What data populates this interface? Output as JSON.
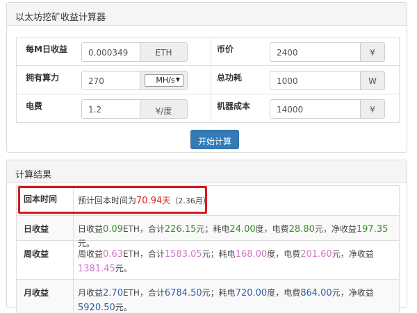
{
  "calc": {
    "title": "以太坊挖矿收益计算器",
    "rows": [
      {
        "left_label": "每M日收益",
        "left_value": "0.000349",
        "left_unit": "ETH",
        "right_label": "币价",
        "right_value": "2400",
        "right_unit": "¥"
      },
      {
        "left_label": "拥有算力",
        "left_value": "270",
        "left_unit_select": "MH/s",
        "right_label": "总功耗",
        "right_value": "1000",
        "right_unit": "W"
      },
      {
        "left_label": "电费",
        "left_value": "1.2",
        "left_unit": "¥/度",
        "right_label": "机器成本",
        "right_value": "14000",
        "right_unit": "¥"
      }
    ],
    "start_button": "开始计算"
  },
  "result": {
    "title": "计算结果",
    "payback": {
      "label": "回本时间",
      "prefix": "预计回本时间为",
      "days": "70.94",
      "days_unit": "天",
      "months": "（2.36月）"
    },
    "daily": {
      "label": "日收益",
      "t1": "日收益",
      "v1": "0.09",
      "t2": "ETH，合计",
      "v2": "226.15",
      "t3": "元；耗电",
      "v3": "24.00",
      "t4": "度，电费",
      "v4": "28.80",
      "t5": "元，净收益",
      "v5": "197.35",
      "t6": "元。"
    },
    "weekly": {
      "label": "周收益",
      "t1": "周收益",
      "v1": "0.63",
      "t2": "ETH，合计",
      "v2": "1583.05",
      "t3": "元；耗电",
      "v3": "168.00",
      "t4": "度，电费",
      "v4": "201.60",
      "t5": "元，净收益",
      "v5": "1381.45",
      "t6": "元。"
    },
    "monthly": {
      "label": "月收益",
      "t1": "月收益",
      "v1": "2.70",
      "t2": "ETH，合计",
      "v2": "6784.50",
      "t3": "元；耗电",
      "v3": "720.00",
      "t4": "度，电费",
      "v4": "864.00",
      "t5": "元，净收益",
      "v5": "5920.50",
      "t6": "元。"
    }
  },
  "colors": {
    "primary_button": "#337ab7",
    "highlight": "#d7191c",
    "daily_values": "#3c8d2e",
    "weekly_values": "#d076c8",
    "monthly_values": "#2b5fa8",
    "payback_value": "#d9241f"
  }
}
